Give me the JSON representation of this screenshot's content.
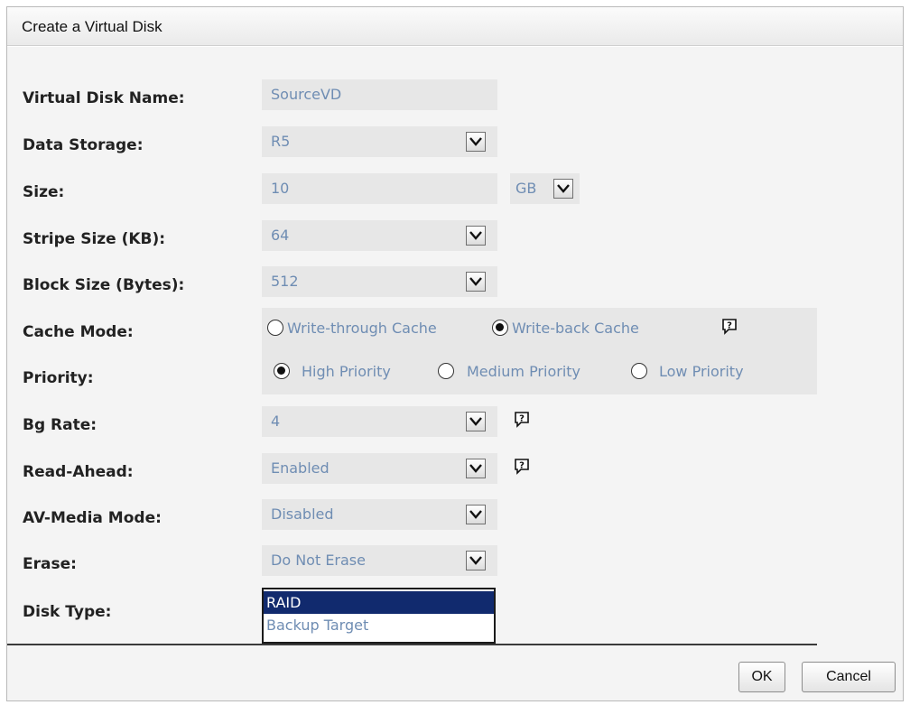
{
  "dialog": {
    "title": "Create a Virtual Disk"
  },
  "form": {
    "virtual_disk_name": {
      "label": "Virtual Disk Name:",
      "value": "SourceVD"
    },
    "data_storage": {
      "label": "Data Storage:",
      "value": "R5"
    },
    "size": {
      "label": "Size:",
      "value": "10",
      "unit": "GB"
    },
    "stripe_size": {
      "label": "Stripe Size (KB):",
      "value": "64"
    },
    "block_size": {
      "label": "Block Size (Bytes):",
      "value": "512"
    },
    "cache_mode": {
      "label": "Cache Mode:",
      "options": [
        "Write-through Cache",
        "Write-back Cache"
      ],
      "selected": "Write-back Cache"
    },
    "priority": {
      "label": "Priority:",
      "options": [
        "High Priority",
        "Medium Priority",
        "Low Priority"
      ],
      "selected": "High Priority"
    },
    "bg_rate": {
      "label": "Bg Rate:",
      "value": "4"
    },
    "read_ahead": {
      "label": "Read-Ahead:",
      "value": "Enabled"
    },
    "av_media_mode": {
      "label": "AV-Media Mode:",
      "value": "Disabled"
    },
    "erase": {
      "label": "Erase:",
      "value": "Do Not Erase"
    },
    "disk_type": {
      "label": "Disk Type:",
      "options": [
        "RAID",
        "Backup Target"
      ],
      "selected": "RAID"
    }
  },
  "buttons": {
    "ok": "OK",
    "cancel": "Cancel"
  },
  "icons": {
    "dropdown": "chevron-down-icon",
    "help": "help-icon"
  },
  "colors": {
    "value_text": "#6f8db3",
    "selected_bg": "#112a6e",
    "field_bg": "#e7e7e7"
  }
}
